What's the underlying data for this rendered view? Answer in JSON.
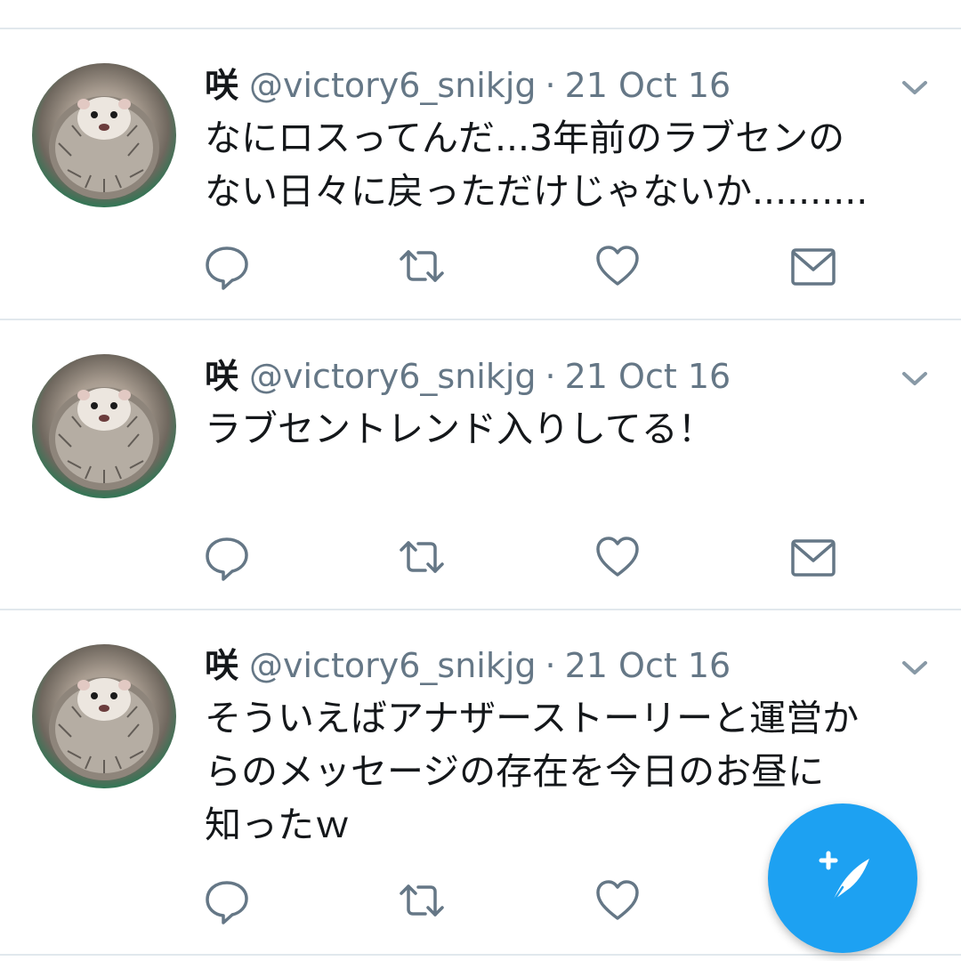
{
  "tweets": [
    {
      "author_name": "咲",
      "handle": "@victory6_snikjg",
      "separator": "·",
      "date": "21 Oct 16",
      "text_lines": [
        "なにロスってんだ...3年前のラブセンの",
        "ない日々に戻っただけじゃないか.........."
      ]
    },
    {
      "author_name": "咲",
      "handle": "@victory6_snikjg",
      "separator": "·",
      "date": "21 Oct 16",
      "text_lines": [
        "ラブセントレンド入りしてる！"
      ]
    },
    {
      "author_name": "咲",
      "handle": "@victory6_snikjg",
      "separator": "·",
      "date": "21 Oct 16",
      "text_lines": [
        "そういえばアナザーストーリーと運営か",
        "らのメッセージの存在を今日のお昼に",
        "知ったｗ"
      ]
    }
  ],
  "icons": {
    "reply": "reply-icon",
    "retweet": "retweet-icon",
    "like": "heart-icon",
    "message": "envelope-icon",
    "menu": "chevron-down-icon",
    "compose": "compose-tweet-icon"
  },
  "colors": {
    "text": "#14171a",
    "secondary": "#657786",
    "divider": "#e1e8ed",
    "accent": "#1da1f2"
  }
}
